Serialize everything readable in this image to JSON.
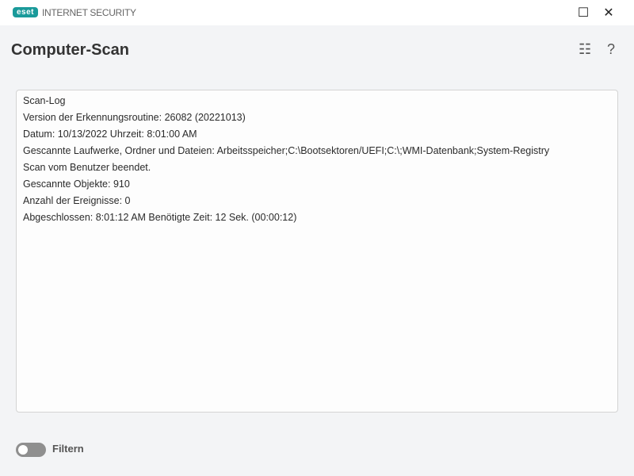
{
  "titlebar": {
    "logo": "eset",
    "app_name": "INTERNET SECURITY",
    "maximize": "☐",
    "close": "✕"
  },
  "header": {
    "title": "Computer-Scan",
    "list_icon": "☷",
    "help_icon": "?"
  },
  "log": {
    "lines": [
      "Scan-Log",
      "Version der Erkennungsroutine: 26082 (20221013)",
      "Datum: 10/13/2022  Uhrzeit: 8:01:00 AM",
      "Gescannte Laufwerke, Ordner und Dateien: Arbeitsspeicher;C:\\Bootsektoren/UEFI;C:\\;WMI-Datenbank;System-Registry",
      "Scan vom Benutzer beendet.",
      "Gescannte Objekte: 910",
      "Anzahl der Ereignisse: 0",
      "Abgeschlossen: 8:01:12 AM  Benötigte Zeit: 12 Sek. (00:00:12)"
    ]
  },
  "filter": {
    "label": "Filtern",
    "enabled": false
  }
}
